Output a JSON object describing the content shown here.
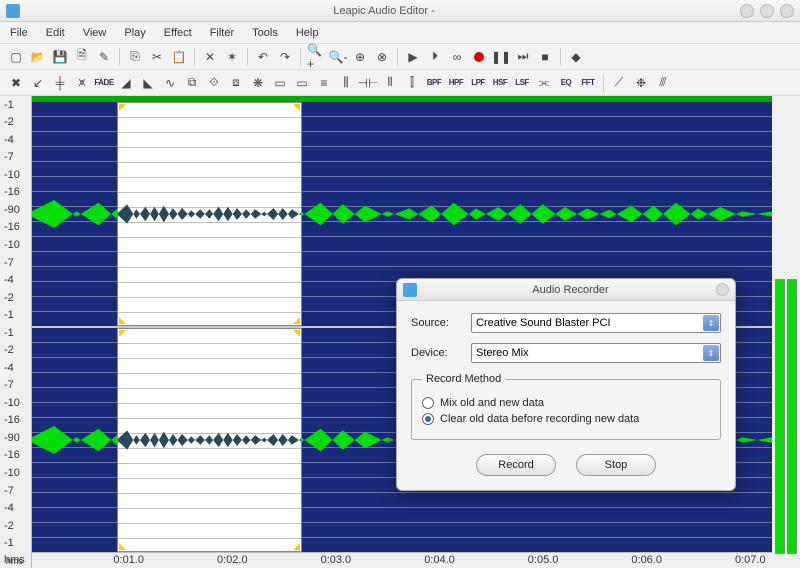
{
  "title": "Leapic Audio Editor -",
  "menu": [
    "File",
    "Edit",
    "View",
    "Play",
    "Effect",
    "Filter",
    "Tools",
    "Help"
  ],
  "toolbar1": [
    {
      "name": "new-icon",
      "glyph": "▢"
    },
    {
      "name": "open-icon",
      "glyph": "📂"
    },
    {
      "name": "save-icon",
      "glyph": "💾"
    },
    {
      "name": "save-as-icon",
      "glyph": "🗎"
    },
    {
      "name": "wand-icon",
      "glyph": "✎"
    },
    {
      "sep": true
    },
    {
      "name": "copy-icon",
      "glyph": "⎘"
    },
    {
      "name": "cut-icon",
      "glyph": "✂"
    },
    {
      "name": "paste-icon",
      "glyph": "📋"
    },
    {
      "sep": true
    },
    {
      "name": "delete-icon",
      "glyph": "✕"
    },
    {
      "name": "crop-icon",
      "glyph": "✶"
    },
    {
      "sep": true
    },
    {
      "name": "undo-icon",
      "glyph": "↶"
    },
    {
      "name": "redo-icon",
      "glyph": "↷"
    },
    {
      "sep": true
    },
    {
      "name": "zoom-in-icon",
      "glyph": "🔍+"
    },
    {
      "name": "zoom-out-icon",
      "glyph": "🔍-"
    },
    {
      "name": "zoom-sel-icon",
      "glyph": "⊕"
    },
    {
      "name": "zoom-fit-icon",
      "glyph": "⊗"
    },
    {
      "sep": true
    },
    {
      "name": "play-icon",
      "glyph": "▶"
    },
    {
      "name": "play-start-icon",
      "glyph": "⏵"
    },
    {
      "name": "loop-icon",
      "glyph": "∞"
    },
    {
      "name": "record-icon",
      "glyph": "●",
      "rec": true
    },
    {
      "name": "pause-icon",
      "glyph": "❚❚"
    },
    {
      "name": "next-icon",
      "glyph": "⏭"
    },
    {
      "name": "stop-icon",
      "glyph": "■"
    },
    {
      "sep": true
    },
    {
      "name": "help-icon",
      "glyph": "◆"
    }
  ],
  "toolbar2": [
    {
      "name": "resample-icon",
      "glyph": "✖"
    },
    {
      "name": "reverse-icon",
      "glyph": "↙"
    },
    {
      "name": "normalize-icon",
      "glyph": "╪"
    },
    {
      "name": "amplify-icon",
      "glyph": "⩙"
    },
    {
      "name": "fade-icon",
      "glyph": "⩚",
      "txt": "FADE"
    },
    {
      "name": "fadein-icon",
      "glyph": "◢"
    },
    {
      "name": "fadeout-icon",
      "glyph": "◣"
    },
    {
      "name": "vibrato-icon",
      "glyph": "∿"
    },
    {
      "name": "delay-icon",
      "glyph": "⧉"
    },
    {
      "name": "pitch-icon",
      "glyph": "⟐"
    },
    {
      "name": "stretch-icon",
      "glyph": "⧈"
    },
    {
      "name": "chorus-icon",
      "glyph": "❋"
    },
    {
      "name": "flanger-icon",
      "glyph": "▭"
    },
    {
      "name": "phaser-icon",
      "glyph": "▭"
    },
    {
      "name": "compress-icon",
      "glyph": "≡"
    },
    {
      "name": "expand-icon",
      "glyph": "⫼"
    },
    {
      "name": "invert-icon",
      "glyph": "⊣⊢"
    },
    {
      "name": "silence-icon",
      "glyph": "⦀"
    },
    {
      "name": "trim-icon",
      "glyph": "⫿"
    },
    {
      "name": "bpf-icon",
      "txt": "BPF"
    },
    {
      "name": "hpf-icon",
      "txt": "HPF"
    },
    {
      "name": "lpf-icon",
      "txt": "LPF"
    },
    {
      "name": "hsf-icon",
      "txt": "HSF"
    },
    {
      "name": "lsf-icon",
      "txt": "LSF"
    },
    {
      "name": "notch-icon",
      "glyph": "⫘"
    },
    {
      "name": "eq-icon",
      "txt": "EQ"
    },
    {
      "name": "fft-icon",
      "txt": "FFT"
    },
    {
      "sep": true
    },
    {
      "name": "noise-icon",
      "glyph": "⟋"
    },
    {
      "name": "denoise-icon",
      "glyph": "❉"
    },
    {
      "name": "analyze-icon",
      "glyph": "⫻"
    }
  ],
  "db_scale": [
    "-1",
    "-2",
    "-4",
    "-7",
    "-10",
    "-16",
    "-90",
    "-16",
    "-10",
    "-7",
    "-4",
    "-2",
    "-1"
  ],
  "time_ticks": [
    {
      "pos": 0,
      "label": "hms"
    },
    {
      "pos": 11,
      "label": "0:01.0"
    },
    {
      "pos": 25,
      "label": "0:02.0"
    },
    {
      "pos": 39,
      "label": "0:03.0"
    },
    {
      "pos": 53,
      "label": "0:04.0"
    },
    {
      "pos": 67,
      "label": "0:05.0"
    },
    {
      "pos": 81,
      "label": "0:06.0"
    },
    {
      "pos": 95,
      "label": "0:07.0"
    }
  ],
  "dialog": {
    "title": "Audio Recorder",
    "source_label": "Source:",
    "source_value": "Creative Sound Blaster PCI",
    "device_label": "Device:",
    "device_value": "Stereo Mix",
    "method_legend": "Record Method",
    "opt_mix": "Mix old and new data",
    "opt_clear": "Clear old data before recording new data",
    "selected_method": "clear",
    "record_btn": "Record",
    "stop_btn": "Stop"
  }
}
